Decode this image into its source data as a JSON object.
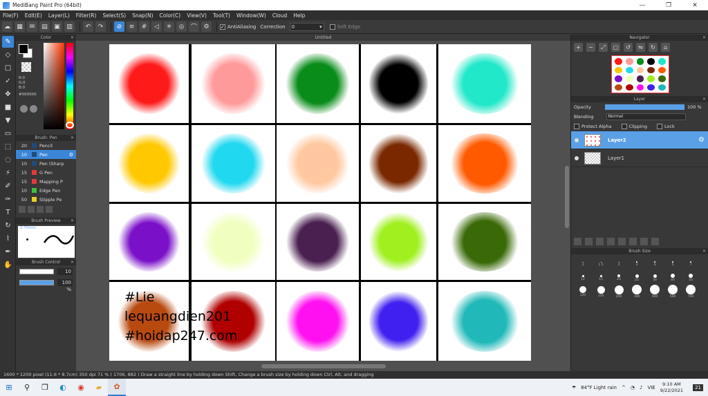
{
  "window": {
    "title": "MediBang Paint Pro (64bit)",
    "minimize": "—",
    "maximize": "❐",
    "close": "✕"
  },
  "menu": [
    "File(F)",
    "Edit(E)",
    "Layer(L)",
    "Filter(R)",
    "Select(S)",
    "Snap(N)",
    "Color(C)",
    "View(V)",
    "Tool(T)",
    "Window(W)",
    "Cloud",
    "Help"
  ],
  "toolbar": {
    "antialiasing_label": "AntiAliasing",
    "correction_label": "Correction",
    "correction_value": "0",
    "soft_edge_label": "Soft Edge"
  },
  "panels": {
    "color": {
      "title": "Color",
      "r": "R:0",
      "g": "G:0",
      "b": "B:0",
      "hex": "#000000"
    },
    "brush": {
      "title": "Brush: Pen",
      "items": [
        {
          "size": "20",
          "name": "Pencil",
          "color": "#1e4c7a"
        },
        {
          "size": "10",
          "name": "Pen",
          "color": "#1e4c7a"
        },
        {
          "size": "10",
          "name": "Pen (Sharp",
          "color": "#1e4c7a"
        },
        {
          "size": "15",
          "name": "G Pen",
          "color": "#e23a3a"
        },
        {
          "size": "15",
          "name": "Mapping P",
          "color": "#e23a3a"
        },
        {
          "size": "10",
          "name": "Edge Pen",
          "color": "#3cc23c"
        },
        {
          "size": "50",
          "name": "Stipple Pe",
          "color": "#e8d020"
        }
      ]
    },
    "brush_preview": {
      "title": "Brush Preview",
      "size": "0.70mm"
    },
    "brush_control": {
      "title": "Brush Control",
      "size_value": "10",
      "opacity_value": "100 %"
    },
    "canvas_tab": "Untitled",
    "navigator": {
      "title": "Navigator"
    },
    "layer": {
      "title": "Layer",
      "opacity_label": "Opacity",
      "opacity_value": "100 %",
      "blending_label": "Blending",
      "blending_value": "Normal",
      "protect_alpha": "Protect Alpha",
      "clipping": "Clipping",
      "lock": "Lock",
      "layers": [
        {
          "name": "Layer2",
          "selected": true
        },
        {
          "name": "Layer1",
          "selected": false
        }
      ]
    },
    "brush_size": {
      "title": "Brush Size",
      "sizes": [
        "1",
        "1.5",
        "2",
        "3",
        "4",
        "5",
        "7",
        "12",
        "15",
        "20",
        "25",
        "30",
        "40",
        "50",
        "120",
        "150",
        "200",
        "300",
        "400",
        "500",
        "700"
      ]
    }
  },
  "canvas": {
    "colors": [
      [
        "#ff1a1a",
        "#ff9a9a",
        "#0a8c1a",
        "#000000",
        "#20e8c8"
      ],
      [
        "#ffc800",
        "#20d8f0",
        "#ffc8a0",
        "#7a2800",
        "#ff5a00"
      ],
      [
        "#7a10c8",
        "#f0ffc0",
        "#4a2050",
        "#a0f020",
        "#3a6a08"
      ],
      [
        "#b84a10",
        "#b00000",
        "#ff10f0",
        "#4020f0",
        "#20b8b8"
      ]
    ],
    "watermark": [
      "#Lie",
      "lequangdien201",
      "#hoidap247.com"
    ]
  },
  "status": "1600 * 1200 pixel  (11.6 * 8.7cm)  350 dpi  71 %  ( 1706, 882 )  Draw a straight line by holding down Shift, Change a brush size by holding down Ctrl, Alt, and dragging",
  "taskbar": {
    "weather": "84°F  Light rain",
    "lang": "VIE",
    "time": "9:10 AM",
    "date": "9/22/2021",
    "notif": "21"
  }
}
